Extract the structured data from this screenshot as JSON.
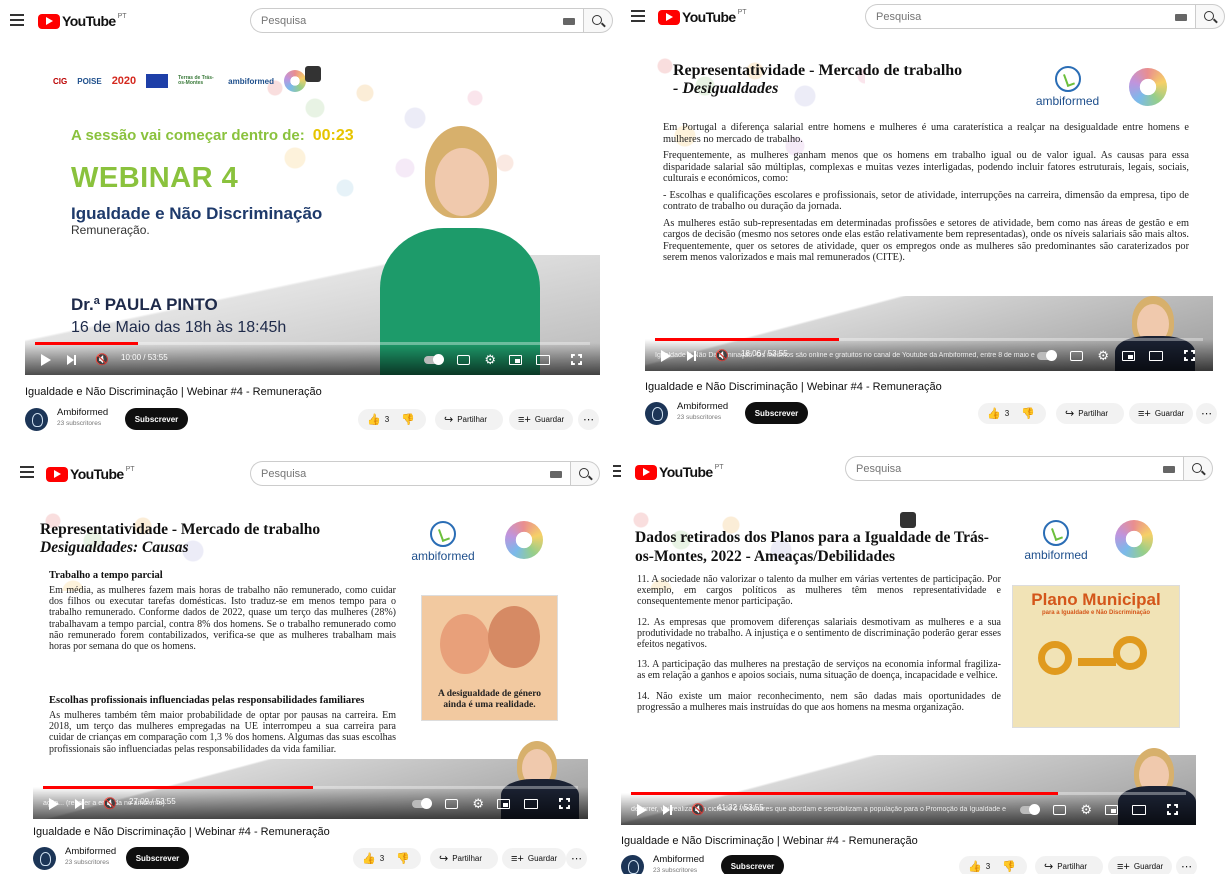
{
  "header": {
    "logo_text": "YouTube",
    "country": "PT",
    "search_placeholder": "Pesquisa"
  },
  "video": {
    "title": "Igualdade e Não Discriminação | Webinar #4 - Remuneração",
    "channel": "Ambiformed",
    "subscribers": "23 subscritores",
    "subscribe_label": "Subscrever",
    "likes": "3",
    "share_label": "Partilhar",
    "save_label": "Guardar"
  },
  "panels": [
    {
      "time": "10:00 / 53:55",
      "progress": 0.185,
      "webinar": {
        "logos": [
          "CIG",
          "POISE",
          "2020",
          "Terras de Trás-os-Montes",
          "ambiformed"
        ],
        "countdown_label": "A sessão vai começar dentro de:",
        "countdown_value": "00:23",
        "title": "WEBINAR 4",
        "subtitle": "Igualdade e Não Discriminação",
        "subtitle2": "Remuneração.",
        "speaker": "Dr.ª PAULA PINTO",
        "date": "16 de Maio das 18h às 18:45h"
      }
    },
    {
      "time": "18:06 / 53:55",
      "progress": 0.335,
      "ticker": "Igualdade e Não Discriminação. Os mesmos são online e gratuitos no canal de Youtube da Ambiformed, entre 8 de maio e 18:45",
      "slide_title": "Representatividade - Mercado de trabalho",
      "slide_title2": "- Desigualdades",
      "paragraphs": [
        "Em Portugal a diferença salarial entre homens e mulheres é uma caraterística a realçar na desigualdade entre homens e mulheres no mercado de trabalho.",
        "Frequentemente, as mulheres ganham menos que os homens em trabalho igual ou de valor igual. As causas para essa disparidade salarial são múltiplas, complexas e muitas vezes interligadas, podendo incluir fatores estruturais, legais, sociais, culturais e económicos, como:",
        "- Escolhas e qualificações escolares e profissionais, setor de atividade, interrupções na carreira, dimensão da empresa, tipo de contrato de trabalho ou duração da jornada.",
        "As mulheres estão sub-representadas em determinadas profissões e setores de atividade, bem como nas áreas de gestão e em cargos de decisão (mesmo nos setores onde elas estão relativamente bem representadas), onde os níveis salariais são mais altos. Frequentemente, quer os setores de atividade, quer os empregos onde as mulheres são predominantes são caraterizados por serem menos valorizados e mais mal remunerados (CITE)."
      ],
      "brand": "ambiformed"
    },
    {
      "time": "27:09 / 53:55",
      "progress": 0.505,
      "ticker": "ação... (rebater a entrada no ambiente)",
      "slide_title": "Representatividade - Mercado de trabalho",
      "slide_title2": "Desigualdades: Causas",
      "section1": "Trabalho a tempo parcial",
      "para1": "Em média, as mulheres fazem mais horas de trabalho não remunerado, como cuidar dos filhos ou executar tarefas domésticas. Isto traduz-se em menos tempo para o trabalho remunerado. Conforme dados de 2022, quase um terço das mulheres (28%) trabalhavam a tempo parcial, contra 8% dos homens. Se o trabalho remunerado como não remunerado forem contabilizados, verifica-se que as mulheres trabalham mais horas por semana do que os homens.",
      "section2": "Escolhas profissionais influenciadas pelas responsabilidades familiares",
      "para2": "As mulheres também têm maior probabilidade de optar por pausas na carreira. Em 2018, um terço das mulheres empregadas na UE interrompeu a sua carreira para cuidar de crianças em comparação com 1,3 % dos homens. Algumas das suas escolhas profissionais são influenciadas pelas responsabilidades da vida familiar.",
      "image_caption": "A desigualdade de género ainda é uma realidade.",
      "brand": "ambiformed"
    },
    {
      "time": "41:32 / 53:55",
      "progress": 0.77,
      "ticker": "decorrer, vai realizar um ciclo de 6 Webinares que abordam e sensibilizam a população para o Promoção da Igualdade e",
      "slide_title": "Dados retirados dos Planos para a Igualdade de Trás-os-Montes, 2022 - Ameaças/Debilidades",
      "items": [
        "11. A sociedade não valorizar o talento da mulher em várias vertentes de participação. Por exemplo, em cargos políticos as mulheres têm menos representatividade e consequentemente menor participação.",
        "12. As empresas que promovem diferenças salariais desmotivam as mulheres e a sua produtividade no trabalho. A injustiça e o sentimento de discriminação poderão gerar esses efeitos negativos.",
        "13. A participação das mulheres na prestação de serviços na economia informal fragiliza-as em relação a ganhos e apoios sociais, numa situação de doença, incapacidade e velhice.",
        "14. Não existe um maior reconhecimento, nem são dadas mais oportunidades de progressão a mulheres mais instruídas do que aos homens na mesma organização."
      ],
      "plano_title": "Plano Municipal",
      "plano_sub": "para a Igualdade e Não Discriminação",
      "brand": "ambiformed"
    }
  ],
  "colors": {
    "accent": "#ff0000",
    "green": "#8ac23d",
    "navy": "#1e3a6b"
  }
}
